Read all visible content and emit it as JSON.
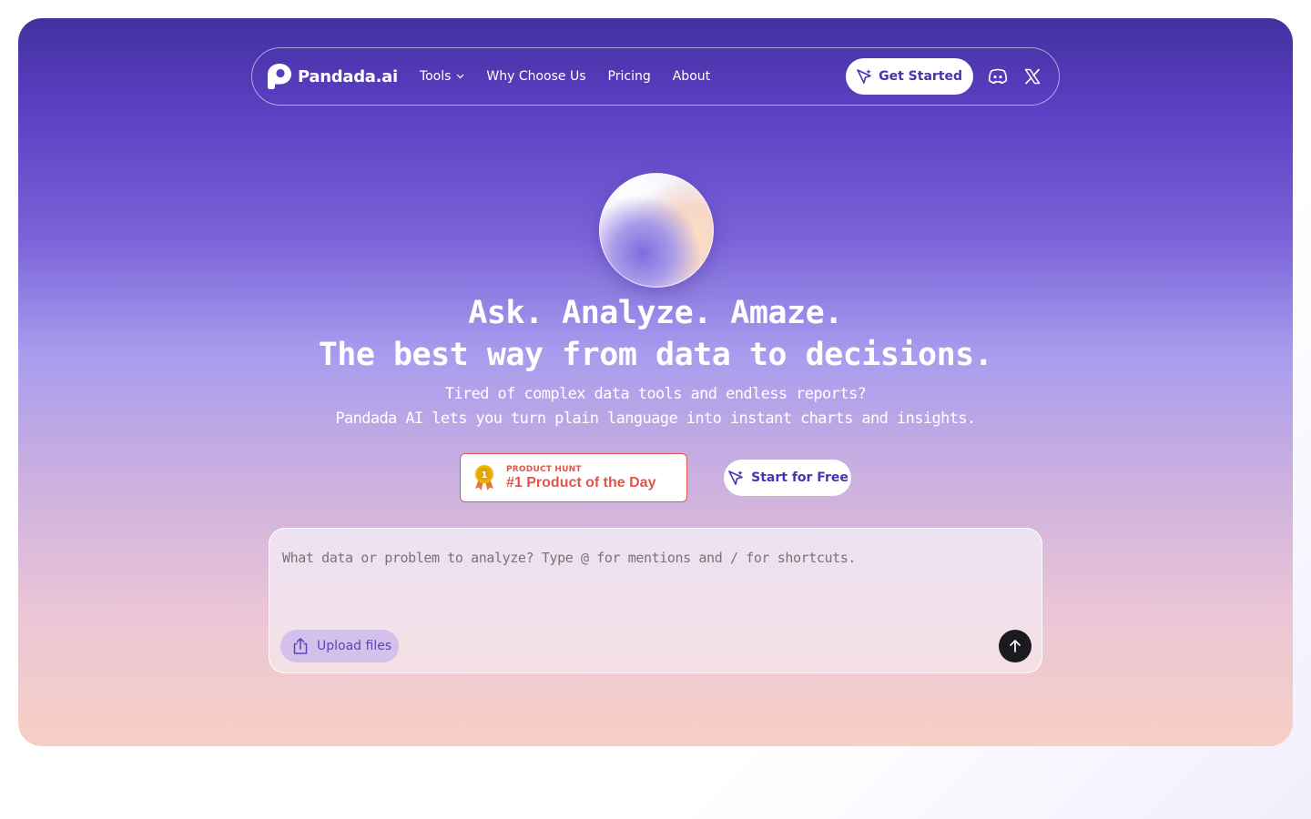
{
  "nav": {
    "logo_text": "Pandada.ai",
    "links": [
      "Tools",
      "Why Choose Us",
      "Pricing",
      "About"
    ],
    "cta_label": "Get Started",
    "social_icons": [
      "discord-icon",
      "x-icon"
    ]
  },
  "hero": {
    "headline_line1": "Ask. Analyze. Amaze.",
    "headline_line2": "The best way from data to decisions.",
    "subtitle_line1": "Tired of complex data tools and endless reports?",
    "subtitle_line2": "Pandada AI lets you turn plain language into instant charts and insights."
  },
  "product_hunt": {
    "small_label": "PRODUCT HUNT",
    "title": "#1 Product of the Day",
    "medal_number": "1"
  },
  "start_button": {
    "label": "Start for Free"
  },
  "prompt": {
    "placeholder": "What data or problem to analyze? Type @ for mentions and / for shortcuts.",
    "upload_label": "Upload files"
  },
  "colors": {
    "accent": "#4a32b0",
    "product_hunt": "#e0564a",
    "send_button": "#1b1b1f"
  }
}
